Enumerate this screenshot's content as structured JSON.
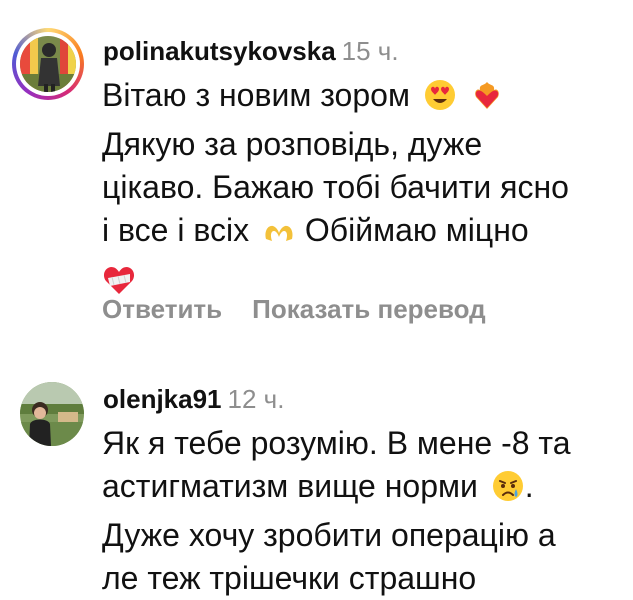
{
  "comments": [
    {
      "username": "polinakutsykovska",
      "time": "15 ч.",
      "lines": [
        {
          "text": "Вітаю з новим зором",
          "emojis": [
            "heart-eyes",
            "fire-heart"
          ]
        },
        {
          "text": "Дякую за розповідь, дуже",
          "emojis": []
        },
        {
          "text": "цікаво. Бажаю тобі бачити ясно",
          "emojis": []
        },
        {
          "text": "і все і всіх",
          "emojis": [
            "heart-hands"
          ],
          "after": "Обіймаю міцно"
        },
        {
          "text": "",
          "emojis": [
            "mending-heart"
          ]
        }
      ],
      "actions": {
        "reply": "Ответить",
        "translate": "Показать перевод"
      }
    },
    {
      "username": "olenjka91",
      "time": "12 ч.",
      "lines": [
        {
          "text": "Як я тебе розумію. В мене -8 та"
        },
        {
          "text": "астигматизм вище норми",
          "emoji": "crying-face",
          "after": "."
        },
        {
          "text": "Дуже хочу зробити операцію а"
        },
        {
          "text": "ле теж трішечки страшно"
        }
      ]
    }
  ],
  "colors": {
    "text": "#111111",
    "secondary": "#8e8e8e",
    "background": "#ffffff"
  }
}
